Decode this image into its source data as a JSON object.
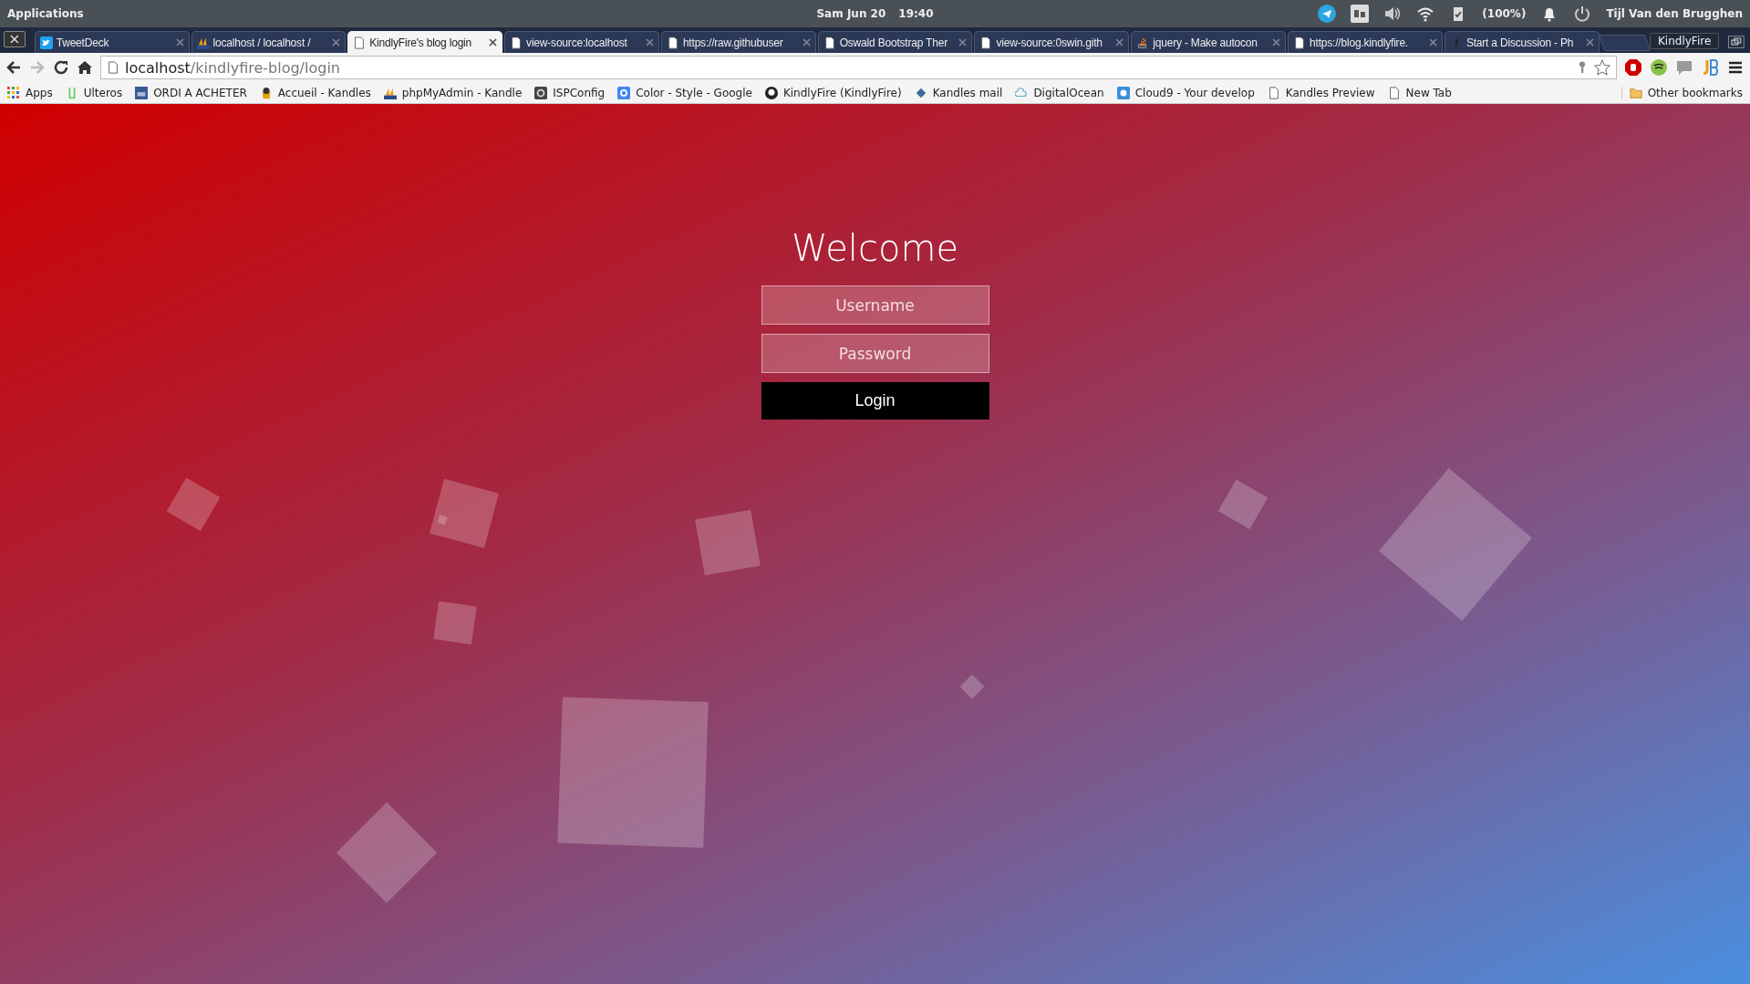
{
  "top_panel": {
    "menu": "Applications",
    "date": "Sam Jun 20",
    "time": "19:40",
    "battery": "(100%)",
    "user": "Tijl Van den Brugghen"
  },
  "tabs": [
    {
      "title": "TweetDeck",
      "kind": "twitter",
      "selected": false
    },
    {
      "title": "localhost / localhost /",
      "kind": "pma",
      "selected": false
    },
    {
      "title": "KindlyFire's blog login",
      "kind": "page",
      "selected": true
    },
    {
      "title": "view-source:localhost",
      "kind": "page",
      "selected": false
    },
    {
      "title": "https://raw.githubuser",
      "kind": "page",
      "selected": false
    },
    {
      "title": "Oswald Bootstrap Ther",
      "kind": "page",
      "selected": false
    },
    {
      "title": "view-source:0swin.gith",
      "kind": "page",
      "selected": false
    },
    {
      "title": "jquery - Make autocon",
      "kind": "stack",
      "selected": false
    },
    {
      "title": "https://blog.kindlyfire.",
      "kind": "page",
      "selected": false
    },
    {
      "title": "Start a Discussion - Ph",
      "kind": "pen",
      "selected": false
    }
  ],
  "profile": "KindlyFire",
  "address": {
    "host": "localhost",
    "path": "/kindlyfire-blog/login"
  },
  "bookmarks": [
    {
      "label": "Apps",
      "kind": "apps"
    },
    {
      "label": "Ulteros",
      "kind": "ulteros"
    },
    {
      "label": "ORDI A ACHETER",
      "kind": "top"
    },
    {
      "label": "Accueil - Kandles",
      "kind": "bucket"
    },
    {
      "label": "phpMyAdmin - Kandle",
      "kind": "pma"
    },
    {
      "label": "ISPConfig",
      "kind": "isp"
    },
    {
      "label": "Color - Style - Google",
      "kind": "google"
    },
    {
      "label": "KindlyFire (KindlyFire)",
      "kind": "github"
    },
    {
      "label": "Kandles mail",
      "kind": "mail"
    },
    {
      "label": "DigitalOcean",
      "kind": "cloud"
    },
    {
      "label": "Cloud9 - Your develop",
      "kind": "cloud9"
    },
    {
      "label": "Kandles Preview",
      "kind": "page"
    },
    {
      "label": "New Tab",
      "kind": "page"
    }
  ],
  "other_bookmarks": "Other bookmarks",
  "login": {
    "title": "Welcome",
    "username": {
      "placeholder": "Username"
    },
    "password": {
      "placeholder": "Password"
    },
    "button": "Login"
  }
}
